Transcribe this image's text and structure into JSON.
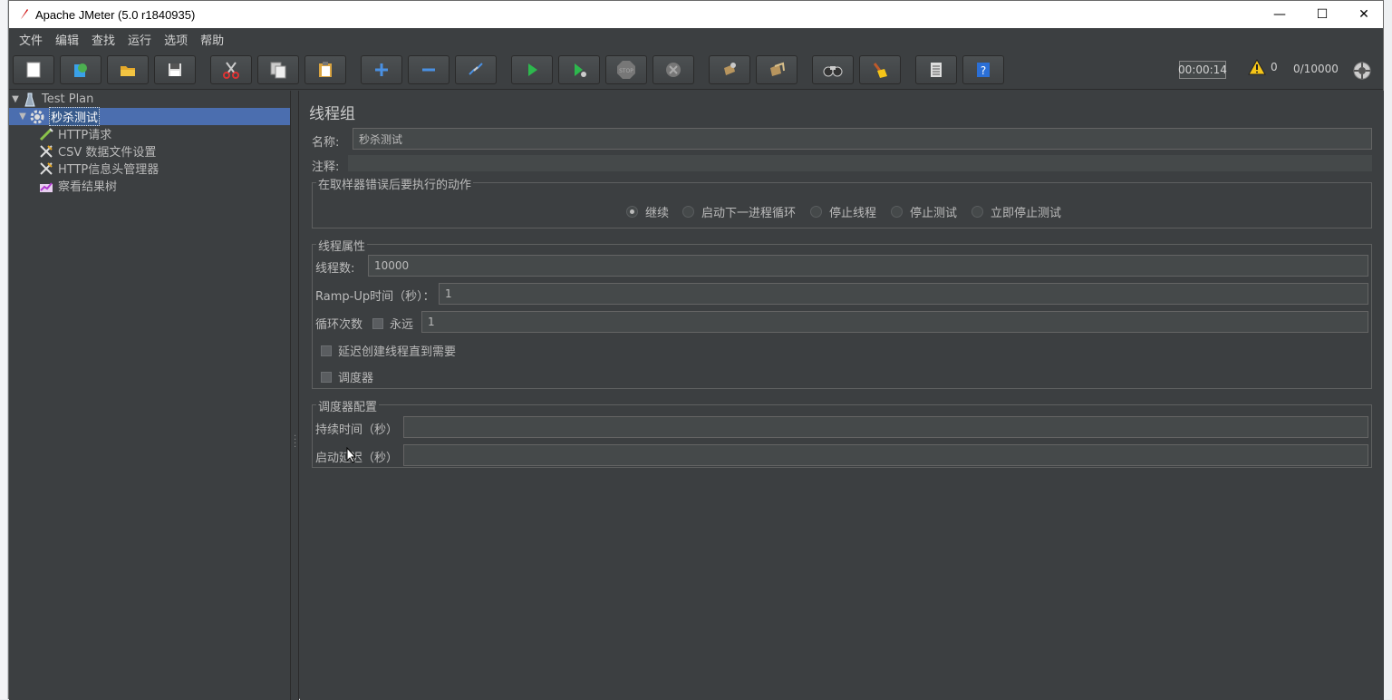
{
  "window": {
    "title": "Apache JMeter (5.0 r1840935)",
    "minimize": "—",
    "maximize": "☐",
    "close": "✕"
  },
  "menu": [
    "文件",
    "编辑",
    "查找",
    "运行",
    "选项",
    "帮助"
  ],
  "toolbar": {
    "buttons": [
      "new-icon",
      "templates-icon",
      "open-icon",
      "save-icon",
      "cut-icon",
      "copy-icon",
      "paste-icon",
      "expand-icon",
      "collapse-icon",
      "toggle-icon",
      "start-icon",
      "start-no-pause-icon",
      "stop-icon",
      "shutdown-icon",
      "clear-icon",
      "clear-all-icon",
      "search-icon",
      "reset-search-icon",
      "function-helper-icon",
      "help-icon"
    ],
    "timer": "00:00:14",
    "warnings": "0",
    "threads": "0/10000"
  },
  "tree": {
    "items": [
      {
        "label": "Test Plan",
        "icon": "test-plan-icon"
      },
      {
        "label": "秒杀测试",
        "icon": "thread-group-gear-icon"
      },
      {
        "label": "HTTP请求",
        "icon": "sampler-pen-icon"
      },
      {
        "label": "CSV 数据文件设置",
        "icon": "config-tools-icon"
      },
      {
        "label": "HTTP信息头管理器",
        "icon": "config-tools-icon"
      },
      {
        "label": "察看结果树",
        "icon": "listener-graph-icon"
      }
    ]
  },
  "panel": {
    "title": "线程组",
    "name_label": "名称:",
    "name_value": "秒杀测试",
    "comment_label": "注释:",
    "comment_value": "",
    "error_group": {
      "title": "在取样器错误后要执行的动作",
      "options": [
        "继续",
        "启动下一进程循环",
        "停止线程",
        "停止测试",
        "立即停止测试"
      ],
      "selected": "继续"
    },
    "thread_group": {
      "title": "线程属性",
      "threads_label": "线程数:",
      "threads_value": "10000",
      "rampup_label": "Ramp-Up时间（秒）：",
      "rampup_value": "1",
      "loop_label": "循环次数",
      "forever_label": "永远",
      "loop_value": "1",
      "delay_label": "延迟创建线程直到需要",
      "scheduler_label": "调度器"
    },
    "scheduler_group": {
      "title": "调度器配置",
      "duration_label": "持续时间（秒）",
      "duration_value": "",
      "startup_label": "启动延迟（秒）",
      "startup_value": ""
    }
  }
}
